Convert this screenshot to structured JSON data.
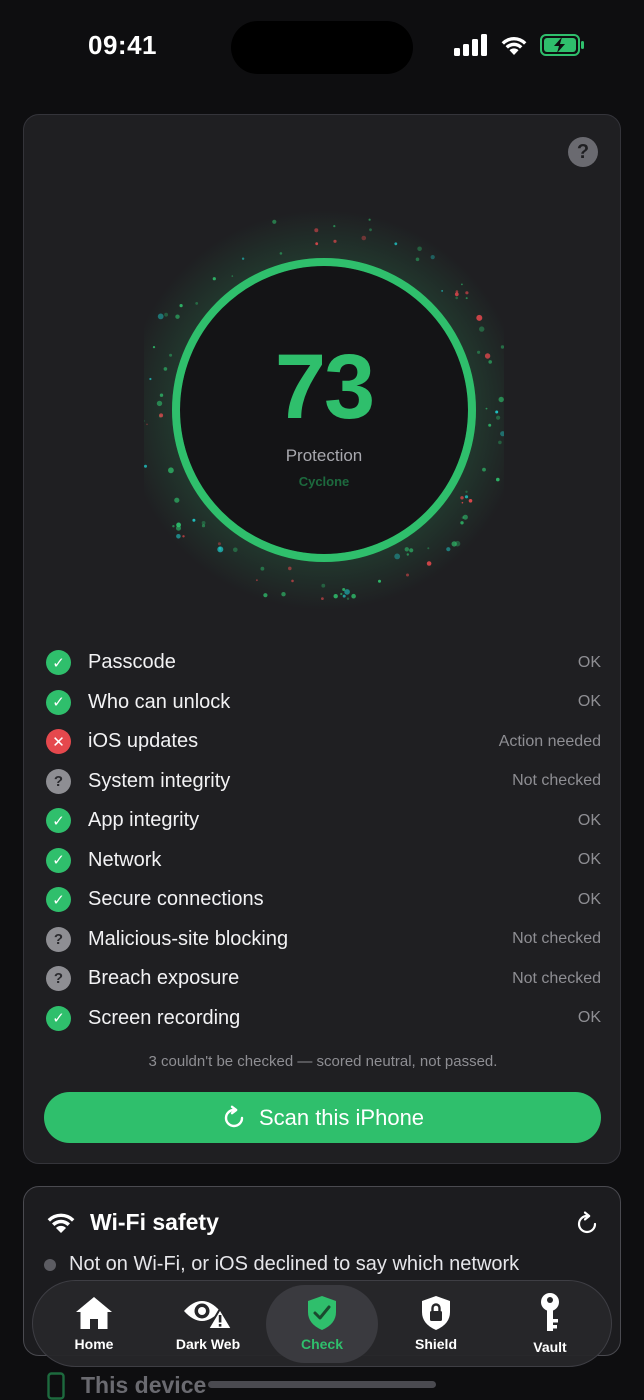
{
  "status_bar": {
    "time": "09:41"
  },
  "colors": {
    "accent": "#2fbf6c",
    "fail": "#e5484d",
    "unknown": "#8e8e93"
  },
  "score": {
    "value": "73",
    "label": "Protection",
    "sublabel": "Cyclone",
    "fraction": 0.73
  },
  "checks": [
    {
      "label": "Passcode",
      "status": "OK",
      "state": "ok"
    },
    {
      "label": "Who can unlock",
      "status": "OK",
      "state": "ok"
    },
    {
      "label": "iOS updates",
      "status": "Action needed",
      "state": "fail"
    },
    {
      "label": "System integrity",
      "status": "Not checked",
      "state": "unknown"
    },
    {
      "label": "App integrity",
      "status": "OK",
      "state": "ok"
    },
    {
      "label": "Network",
      "status": "OK",
      "state": "ok"
    },
    {
      "label": "Secure connections",
      "status": "OK",
      "state": "ok"
    },
    {
      "label": "Malicious-site blocking",
      "status": "Not checked",
      "state": "unknown"
    },
    {
      "label": "Breach exposure",
      "status": "Not checked",
      "state": "unknown"
    },
    {
      "label": "Screen recording",
      "status": "OK",
      "state": "ok"
    }
  ],
  "footnote": "3 couldn't be checked — scored neutral, not passed.",
  "scan_button": {
    "label": "Scan this iPhone",
    "icon": "refresh-icon"
  },
  "wifi_card": {
    "title": "Wi-Fi safety",
    "message": "Not on Wi-Fi, or iOS declined to say which network",
    "icon": "wifi-icon"
  },
  "device_card": {
    "title": "This device"
  },
  "tabs": [
    {
      "label": "Home",
      "icon": "house-icon",
      "active": false
    },
    {
      "label": "Dark Web",
      "icon": "eye-warning-icon",
      "active": false
    },
    {
      "label": "Check",
      "icon": "shield-check-icon",
      "active": true
    },
    {
      "label": "Shield",
      "icon": "shield-lock-icon",
      "active": false
    },
    {
      "label": "Vault",
      "icon": "key-icon",
      "active": false
    }
  ]
}
